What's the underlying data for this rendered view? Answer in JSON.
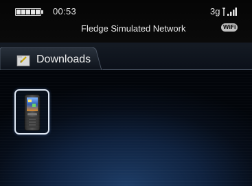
{
  "status": {
    "time": "00:53",
    "carrier": "Fledge Simulated Network",
    "network_type": "3g",
    "wifi_badge": "WiFi",
    "battery_icon": "battery-full-icon",
    "signal_icon": "signal-bars-icon"
  },
  "header": {
    "tab_label": "Downloads",
    "tab_icon": "folder-icon"
  },
  "files": [
    {
      "icon": "phone-file-icon"
    }
  ]
}
